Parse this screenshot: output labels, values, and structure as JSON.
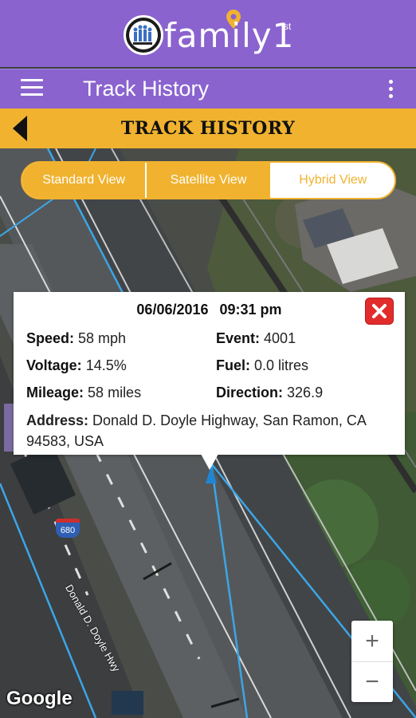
{
  "brand": {
    "logo_text": "family1",
    "logo_superscript": "st",
    "colors": {
      "primary": "#8a63cf",
      "accent": "#f0b22f"
    }
  },
  "toolbar": {
    "menu_icon": "hamburger-menu-icon",
    "title": "Track History",
    "overflow_icon": "more-vert-icon"
  },
  "section": {
    "back_icon": "back-arrow-icon",
    "title": "TRACK HISTORY"
  },
  "view_toggle": {
    "options": [
      "Standard View",
      "Satellite View",
      "Hybrid View"
    ],
    "selected": "Hybrid View"
  },
  "popup": {
    "date": "06/06/2016",
    "time": "09:31 pm",
    "fields": {
      "speed_label": "Speed:",
      "speed_value": "58 mph",
      "event_label": "Event:",
      "event_value": "4001",
      "voltage_label": "Voltage:",
      "voltage_value": "14.5%",
      "fuel_label": "Fuel:",
      "fuel_value": "0.0 litres",
      "mileage_label": "Mileage:",
      "mileage_value": "58 miles",
      "direction_label": "Direction:",
      "direction_value": "326.9",
      "address_label": "Address:",
      "address_value": "Donald D. Doyle Highway, San Ramon, CA 94583, USA"
    },
    "close_icon": "close-icon"
  },
  "map": {
    "interstate_shield": "680",
    "road_label": "Donald D. Doyle Hwy",
    "attribution": "Google",
    "zoom_in": "+",
    "zoom_out": "−"
  }
}
